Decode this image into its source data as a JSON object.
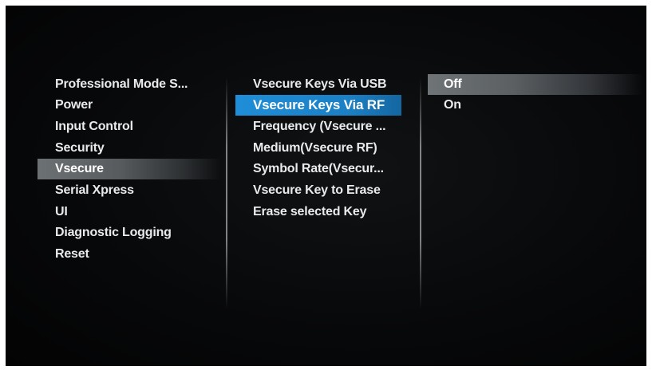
{
  "menu": {
    "categories": [
      {
        "label": "Professional Mode S..."
      },
      {
        "label": "Power"
      },
      {
        "label": "Input Control"
      },
      {
        "label": "Security"
      },
      {
        "label": "Vsecure"
      },
      {
        "label": "Serial Xpress"
      },
      {
        "label": "UI"
      },
      {
        "label": "Diagnostic Logging"
      },
      {
        "label": "Reset"
      }
    ],
    "selected_category": "Vsecure",
    "settings": [
      {
        "label": "Vsecure Keys Via USB"
      },
      {
        "label": "Vsecure Keys Via RF"
      },
      {
        "label": "Frequency (Vsecure ..."
      },
      {
        "label": "Medium(Vsecure RF)"
      },
      {
        "label": "Symbol Rate(Vsecur..."
      },
      {
        "label": "Vsecure Key to Erase"
      },
      {
        "label": "Erase selected Key"
      }
    ],
    "selected_setting": "Vsecure Keys Via RF",
    "options": [
      {
        "label": "Off"
      },
      {
        "label": "On"
      }
    ],
    "selected_option": "Off"
  },
  "colors": {
    "background": "#07080a",
    "text": "#e8eaec",
    "focus_highlight": "#1f8ed8",
    "selection_highlight": "#6c7174"
  }
}
